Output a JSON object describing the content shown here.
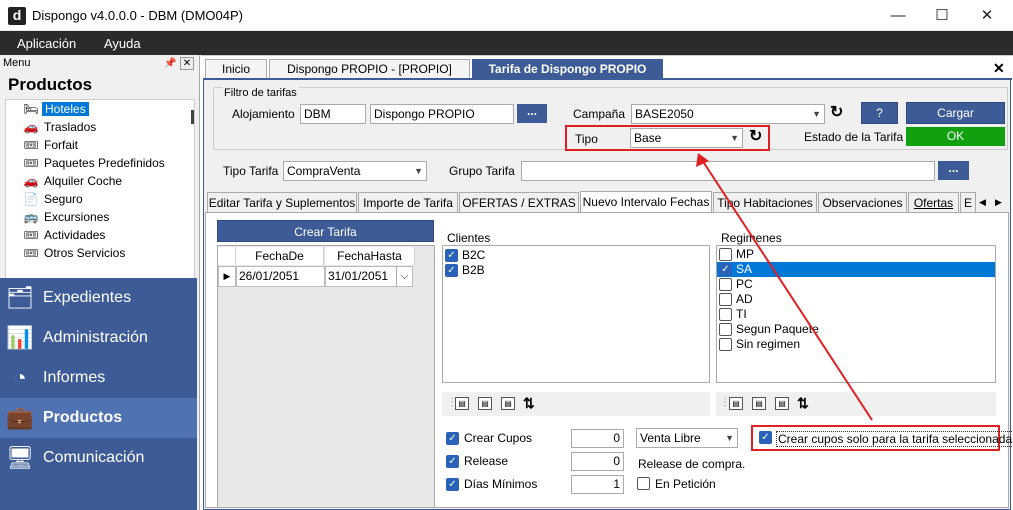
{
  "window": {
    "logo": "d",
    "title": "Dispongo v4.0.0.0 - DBM (DMO04P)",
    "minimize": "—",
    "maximize": "☐",
    "close": "✕"
  },
  "menubar": {
    "items": [
      "Aplicación",
      "Ayuda"
    ]
  },
  "sidebar": {
    "menu_label": "Menu",
    "pin": "📌",
    "close": "✕",
    "section_title": "Productos",
    "tree_items": [
      {
        "label": "Hoteles",
        "icon": "bed-icon",
        "glyph": "🛏",
        "selected": true
      },
      {
        "label": "Traslados",
        "icon": "car-icon",
        "glyph": "🚗"
      },
      {
        "label": "Forfait",
        "icon": "ticket-icon",
        "glyph": "🎟"
      },
      {
        "label": "Paquetes Predefinidos",
        "icon": "ticket-icon",
        "glyph": "🎟"
      },
      {
        "label": "Alquiler Coche",
        "icon": "car-icon",
        "glyph": "🚗"
      },
      {
        "label": "Seguro",
        "icon": "document-icon",
        "glyph": "📄"
      },
      {
        "label": "Excursiones",
        "icon": "bus-icon",
        "glyph": "🚌"
      },
      {
        "label": "Actividades",
        "icon": "ticket-icon",
        "glyph": "🎟"
      },
      {
        "label": "Otros Servicios",
        "icon": "ticket-icon",
        "glyph": "🎟"
      }
    ],
    "nav": [
      {
        "label": "Expedientes",
        "icon": "folder-icon",
        "glyph": "🗂"
      },
      {
        "label": "Administración",
        "icon": "bar-chart-icon",
        "glyph": "📊"
      },
      {
        "label": "Informes",
        "icon": "pie-chart-icon",
        "glyph": "◔"
      },
      {
        "label": "Productos",
        "icon": "briefcase-icon",
        "glyph": "💼",
        "active": true
      },
      {
        "label": "Comunicación",
        "icon": "monitor-icon",
        "glyph": "🖥"
      }
    ]
  },
  "main": {
    "close": "✕",
    "tabs": [
      "Inicio",
      "Dispongo PROPIO - [PROPIO]",
      "Tarifa de Dispongo PROPIO"
    ],
    "filter": {
      "legend": "Filtro de tarifas",
      "alojamiento_label": "Alojamiento",
      "alojamiento_code": "DBM",
      "alojamiento_name": "Dispongo PROPIO",
      "dots": "...",
      "campana_label": "Campaña",
      "campana_value": "BASE2050",
      "help": "?",
      "cargar": "Cargar",
      "tipo_label": "Tipo",
      "tipo_value": "Base",
      "estado_label": "Estado de la Tarifa",
      "estado_value": "OK",
      "estado_color": "#10a010",
      "refresh": "↻"
    },
    "tipo_tarifa_label": "Tipo Tarifa",
    "tipo_tarifa_value": "CompraVenta",
    "grupo_tarifa_label": "Grupo Tarifa",
    "grupo_tarifa_value": "",
    "subtabs": [
      "Editar Tarifa y Suplementos",
      "Importe de Tarifa",
      "OFERTAS / EXTRAS",
      "Nuevo Intervalo Fechas",
      "Tipo Habitaciones",
      "Observaciones",
      "Ofertas",
      "E"
    ],
    "subtab_nav_left": "◀",
    "subtab_nav_right": "▶",
    "crear_tarifa": "Crear Tarifa",
    "grid": {
      "headers": [
        "FechaDe",
        "FechaHasta"
      ],
      "row_marker": "▶",
      "rows": [
        [
          "26/01/2051",
          "31/01/2051"
        ]
      ]
    },
    "clientes": {
      "label": "Clientes",
      "items": [
        {
          "label": "B2C",
          "checked": true
        },
        {
          "label": "B2B",
          "checked": true
        }
      ]
    },
    "regimenes": {
      "label": "Regimenes",
      "items": [
        {
          "label": "MP",
          "checked": false
        },
        {
          "label": "SA",
          "checked": true,
          "selected": true
        },
        {
          "label": "PC",
          "checked": false
        },
        {
          "label": "AD",
          "checked": false
        },
        {
          "label": "TI",
          "checked": false
        },
        {
          "label": "Segun Paquete",
          "checked": false
        },
        {
          "label": "Sin regimen",
          "checked": false
        }
      ]
    },
    "toolbar_glyphs": [
      "▤",
      "▤",
      "▤",
      "⇅"
    ],
    "options": {
      "crear_cupos_label": "Crear Cupos",
      "crear_cupos_value": "0",
      "venta_libre": "Venta Libre",
      "release_label": "Release",
      "release_value": "0",
      "release_compra": "Release de compra.",
      "dias_minimos_label": "Días Mínimos",
      "dias_minimos_value": "1",
      "en_peticion_label": "En Petición",
      "crear_cupos_tarifa_label": "Crear cupos solo para la tarifa seleccionada",
      "check": "✓"
    },
    "annotation_color": "#e02020"
  }
}
